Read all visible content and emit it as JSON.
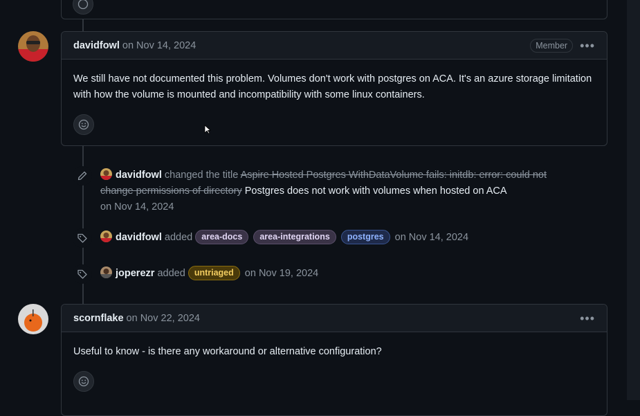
{
  "comments": [
    {
      "author": "davidfowl",
      "date": "on Nov 14, 2024",
      "badge": "Member",
      "body": "We still have not documented this problem. Volumes don't work with postgres on ACA. It's an azure storage limitation with how the volume is mounted and incompatibility with some linux containers.",
      "more_icon": "kebab-horizontal-icon",
      "reaction_icon": "smiley-icon"
    },
    {
      "author": "scornflake",
      "date": "on Nov 22, 2024",
      "body": "Useful to know - is there any workaround or alternative configuration?",
      "more_icon": "kebab-horizontal-icon",
      "reaction_icon": "smiley-icon"
    }
  ],
  "events": [
    {
      "icon": "pencil-icon",
      "author": "davidfowl",
      "action": "changed the title",
      "old_title": "Aspire Hosted Postgres WithDataVolume fails: initdb: error: could not change permissions of directory",
      "new_title": "Postgres does not work with volumes when hosted on ACA",
      "date": "on Nov 14, 2024"
    },
    {
      "icon": "tag-icon",
      "author": "davidfowl",
      "action": "added",
      "labels": [
        "area-docs",
        "area-integrations",
        "postgres"
      ],
      "date": "on Nov 14, 2024"
    },
    {
      "icon": "tag-icon",
      "author": "joperezr",
      "action": "added",
      "labels": [
        "untriaged"
      ],
      "date": "on Nov 19, 2024"
    }
  ],
  "colors": {
    "background": "#0d1117",
    "header": "#161b22",
    "border": "#30363d",
    "muted_text": "#8b949e",
    "label_untriaged": "#f2cc60",
    "label_postgres": "#8fb3ff"
  }
}
